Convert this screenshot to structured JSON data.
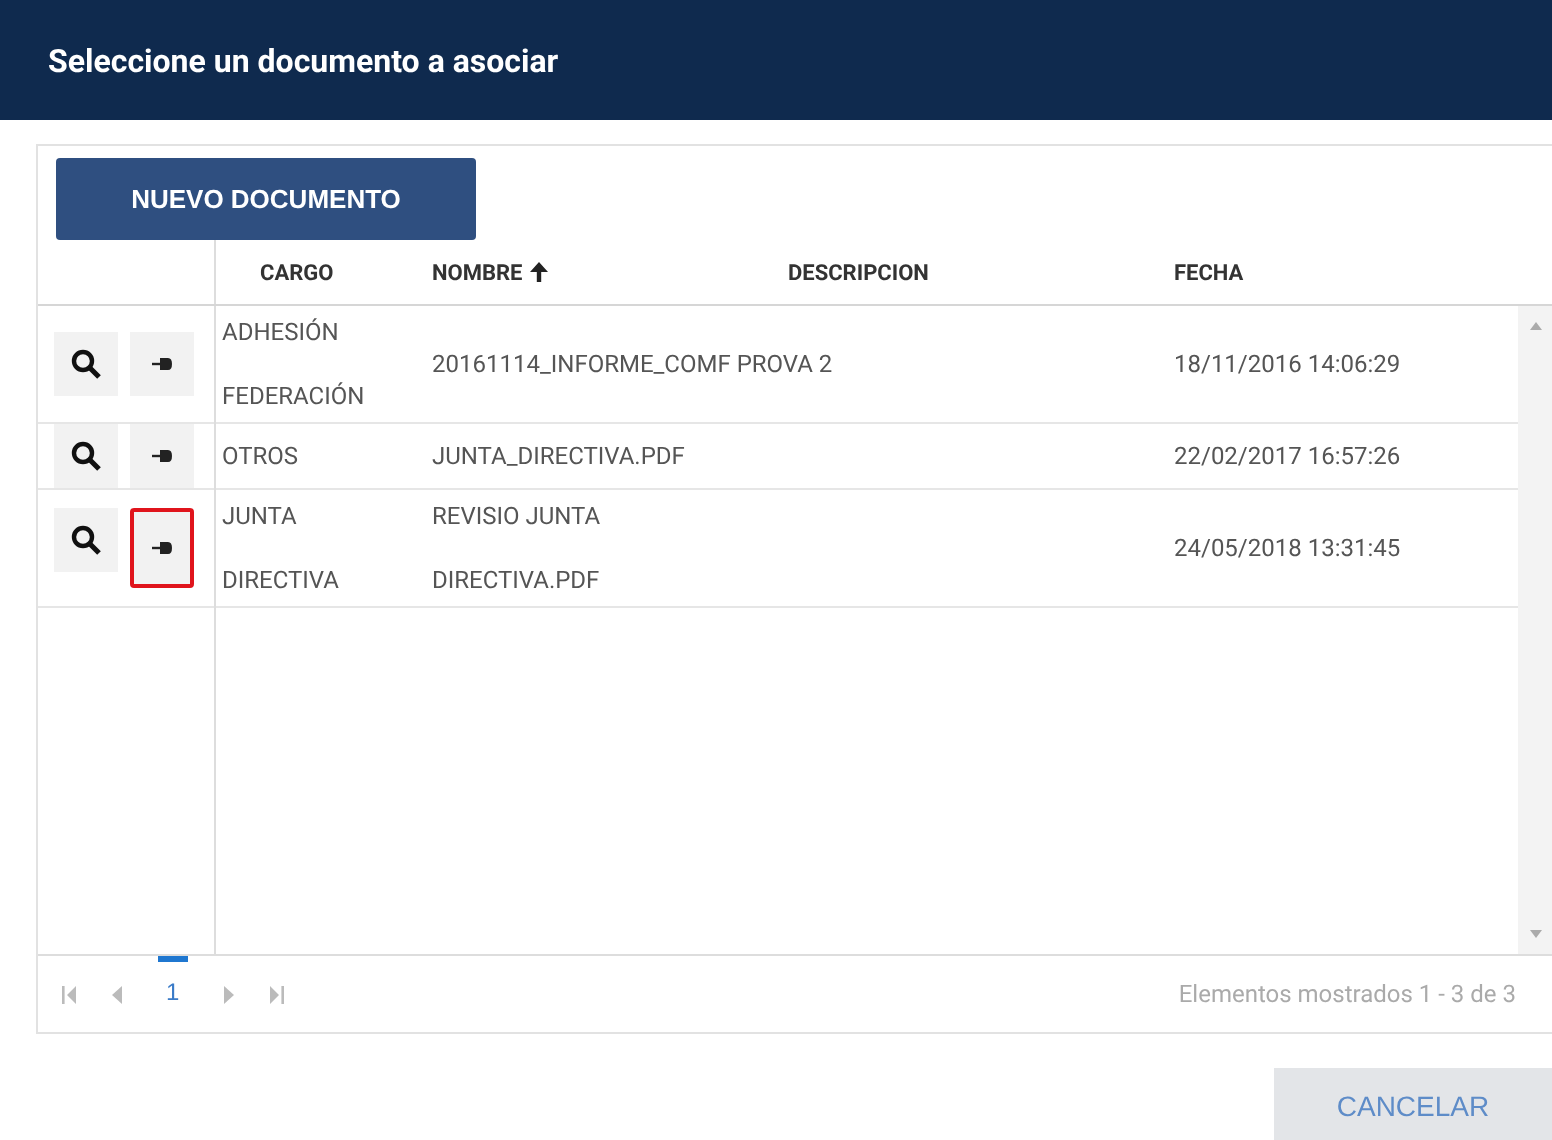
{
  "dialog": {
    "title": "Seleccione un documento a asociar"
  },
  "new_button": "NUEVO DOCUMENTO",
  "table": {
    "columns": [
      {
        "label": "CARGO",
        "sorted": false
      },
      {
        "label": "NOMBRE",
        "sorted": true
      },
      {
        "label": "DESCRIPCION",
        "sorted": false
      },
      {
        "label": "FECHA",
        "sorted": false
      }
    ],
    "rows": [
      {
        "cargo": [
          "ADHESIÓN",
          "FEDERACIÓN"
        ],
        "nombre": [
          "20161114_INFORME_COMF PROVA 2"
        ],
        "fecha": "18/11/2016 14:06:29",
        "highlighted": false
      },
      {
        "cargo": [
          "OTROS"
        ],
        "nombre": [
          "JUNTA_DIRECTIVA.PDF"
        ],
        "fecha": "22/02/2017 16:57:26",
        "highlighted": false
      },
      {
        "cargo": [
          "JUNTA",
          "DIRECTIVA"
        ],
        "nombre": [
          "REVISIO JUNTA",
          "DIRECTIVA.PDF"
        ],
        "fecha": "24/05/2018 13:31:45",
        "highlighted": true
      }
    ]
  },
  "pager": {
    "pages": [
      {
        "label": "1",
        "selected": true
      }
    ],
    "summary": "Elementos mostrados 1 - 3 de 3"
  },
  "cancel_button": "CANCELAR"
}
